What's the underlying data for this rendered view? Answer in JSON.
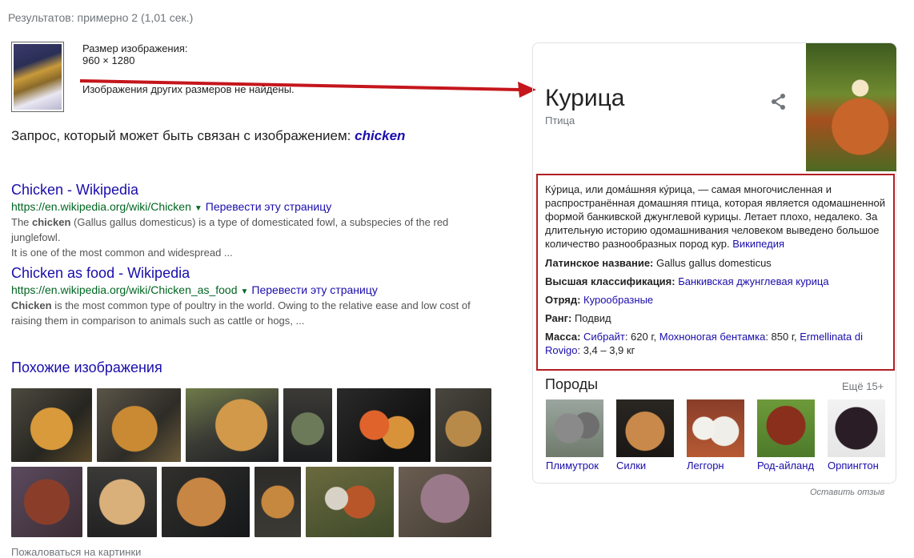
{
  "stats": "Результатов: примерно 2 (1,01 сек.)",
  "image_info": {
    "size_label": "Размер изображения:",
    "size_value": "960 × 1280",
    "no_other_sizes": "Изображения других размеров не найдены."
  },
  "query": {
    "prefix": "Запрос, который может быть связан с изображением:",
    "term": "chicken"
  },
  "results": [
    {
      "title": "Chicken - Wikipedia",
      "url": "https://en.wikipedia.org/wiki/Chicken",
      "translate": "Перевести эту страницу",
      "snippet_bold": "chicken",
      "snippet_pre": "The ",
      "snippet_post": " (Gallus gallus domesticus) is a type of domesticated fowl, a subspecies of the red junglefowl.",
      "snippet_line2": "It is one of the most common and widespread ..."
    },
    {
      "title": "Chicken as food - Wikipedia",
      "url": "https://en.wikipedia.org/wiki/Chicken_as_food",
      "translate": "Перевести эту страницу",
      "snippet_bold": "Chicken",
      "snippet_pre": "",
      "snippet_post": " is the most common type of poultry in the world. Owing to the relative ease and low cost of",
      "snippet_line2": "raising them in comparison to animals such as cattle or hogs, ..."
    }
  ],
  "similar_heading": "Похожие изображения",
  "report_images": "Пожаловаться на картинки",
  "knowledge_panel": {
    "title": "Курица",
    "subtitle": "Птица",
    "description": "Ку́рица, или дома́шняя ку́рица, — самая многочисленная и распространённая домашняя птица, которая является одомашненной формой банкивской джунглевой курицы. Летает плохо, недалеко. За длительную историю одомашнивания человеком выведено большое количество разнообразных пород кур.",
    "source": "Википедия",
    "latin_label": "Латинское название:",
    "latin_value": "Gallus gallus domesticus",
    "class_label": "Высшая классификация:",
    "class_value": "Банкивская джунглевая курица",
    "order_label": "Отряд:",
    "order_value": "Курообразные",
    "rank_label": "Ранг:",
    "rank_value": "Подвид",
    "mass_label": "Масса:",
    "mass_parts": {
      "b1": "Сибрайт",
      "v1": ": 620 г, ",
      "b2": "Мохноногая бентамка",
      "v2": ": 850 г, ",
      "b3": "Ermellinata di Rovigo",
      "v3": ": 3,4 – 3,9 кг"
    },
    "breeds_heading": "Породы",
    "more": "Ещё 15+",
    "breeds": [
      "Плимутрок",
      "Силки",
      "Леггорн",
      "Род-айланд",
      "Орпингтон"
    ],
    "feedback": "Оставить отзыв"
  },
  "colors": {
    "link": "#1a0dab",
    "url_green": "#006621",
    "highlight_border": "#b21f24",
    "arrow": "#c4161c"
  }
}
